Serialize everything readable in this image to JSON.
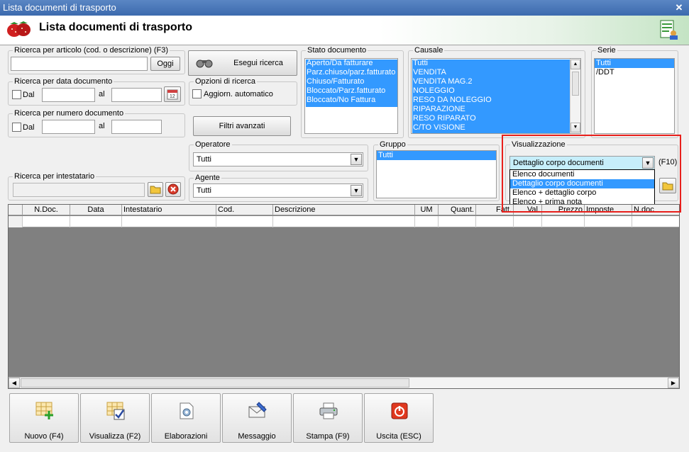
{
  "window": {
    "title": "Lista documenti di trasporto",
    "close_glyph": "✕",
    "header_title": "Lista documenti di trasporto"
  },
  "ricerca_articolo": {
    "legend": "Ricerca per articolo (cod. o descrizione) (F3)",
    "value": "",
    "oggi_label": "Oggi"
  },
  "esegui_ricerca": {
    "label": "Esegui ricerca"
  },
  "ricerca_data": {
    "legend": "Ricerca per data documento",
    "dal_label": "Dal",
    "al_label": "al",
    "dal_value": "",
    "al_value": ""
  },
  "opzioni": {
    "legend": "Opzioni di ricerca",
    "aggiorn_label": "Aggiorn. automatico"
  },
  "ricerca_numero": {
    "legend": "Ricerca per numero documento",
    "dal_label": "Dal",
    "al_label": "al",
    "dal_value": "",
    "al_value": ""
  },
  "filtri_avanzati": {
    "label": "Filtri avanzati"
  },
  "stato_documento": {
    "legend": "Stato documento",
    "items": [
      "Aperto/Da fatturare",
      "Parz.chiuso/parz.fatturato",
      "Chiuso/Fatturato",
      "Bloccato/Parz.fatturato",
      "Bloccato/No Fattura"
    ]
  },
  "causale": {
    "legend": "Causale",
    "items": [
      "Tutti",
      "VENDITA",
      "VENDITA MAG.2",
      "NOLEGGIO",
      "RESO DA NOLEGGIO",
      "RIPARAZIONE",
      "RESO RIPARATO",
      "C/TO VISIONE"
    ]
  },
  "serie": {
    "legend": "Serie",
    "items": [
      "Tutti",
      "/DDT"
    ],
    "selected": "Tutti"
  },
  "operatore": {
    "legend": "Operatore",
    "value": "Tutti"
  },
  "gruppo": {
    "legend": "Gruppo",
    "items": [
      "Tutti"
    ]
  },
  "visualizzazione": {
    "legend": "Visualizzazione",
    "value": "Dettaglio corpo documenti",
    "shortcut": "(F10)",
    "options": [
      "Elenco documenti",
      "Dettaglio corpo documenti",
      "Elenco + dettaglio corpo",
      "Elenco + prima nota"
    ],
    "highlighted": "Dettaglio corpo documenti"
  },
  "ricerca_intestatario": {
    "legend": "Ricerca per intestatario",
    "value": ""
  },
  "agente": {
    "legend": "Agente",
    "value": "Tutti"
  },
  "grid": {
    "columns": [
      "",
      "N.Doc.",
      "Data",
      "Intestatario",
      "Cod.",
      "Descrizione",
      "UM",
      "Quant.",
      "Fatt.",
      "Val.",
      "Prezzo",
      "Imposte",
      "N.doc"
    ]
  },
  "toolbar": {
    "nuovo": "Nuovo (F4)",
    "visualizza": "Visualizza (F2)",
    "elaborazioni": "Elaborazioni",
    "messaggio": "Messaggio",
    "stampa": "Stampa (F9)",
    "uscita": "Uscita (ESC)"
  },
  "colors": {
    "selection": "#3399ff",
    "highlight_box": "#e8201c",
    "titlebar": "#3c6aae"
  }
}
